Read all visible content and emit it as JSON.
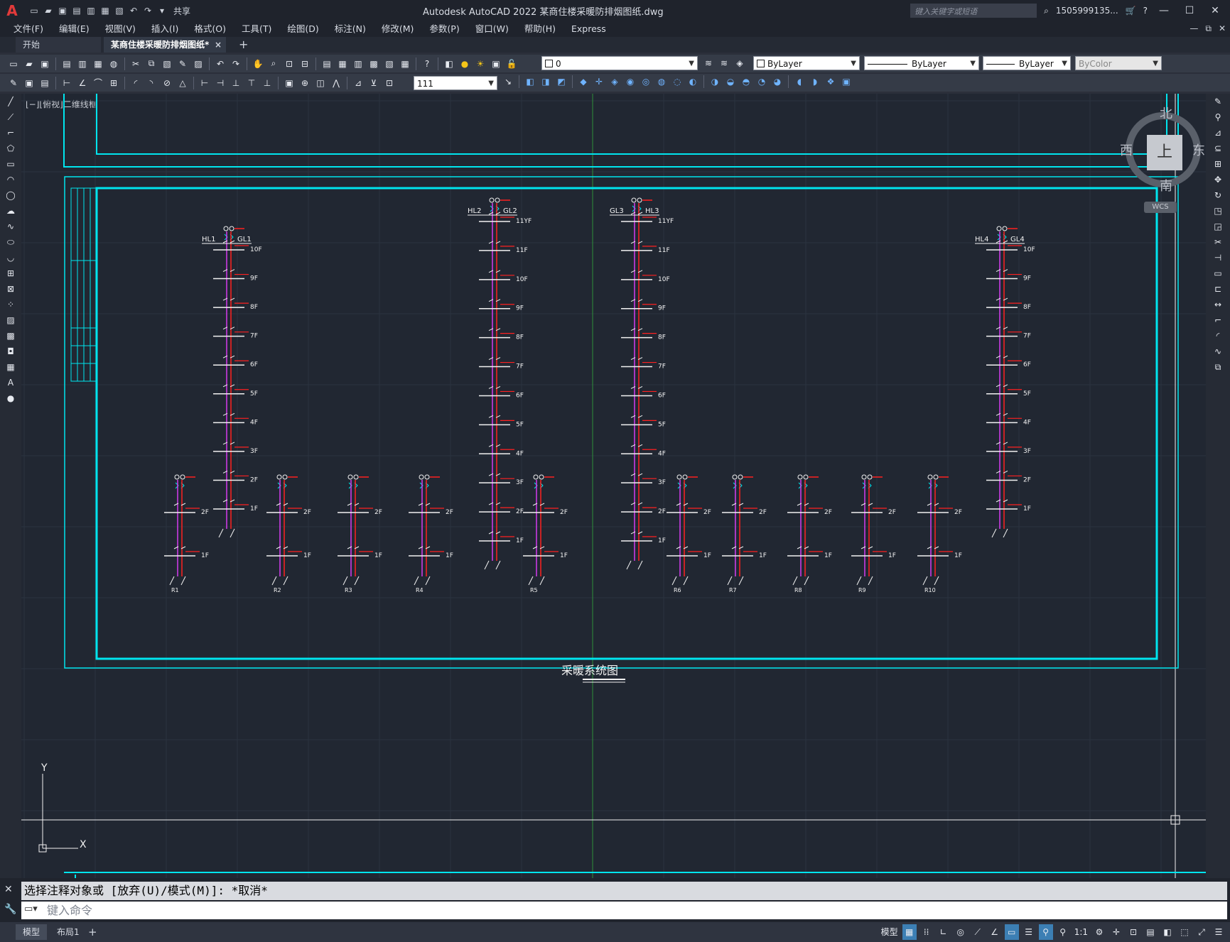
{
  "app": {
    "title": "Autodesk AutoCAD 2022    某商住楼采暖防排烟图纸.dwg",
    "logo": "A",
    "share_label": "共享",
    "search_placeholder": "键入关键字或短语",
    "user": "1505999135...",
    "window_controls": [
      "—",
      "☐",
      "✕"
    ]
  },
  "menu": {
    "items": [
      "文件(F)",
      "编辑(E)",
      "视图(V)",
      "插入(I)",
      "格式(O)",
      "工具(T)",
      "绘图(D)",
      "标注(N)",
      "修改(M)",
      "参数(P)",
      "窗口(W)",
      "帮助(H)",
      "Express"
    ],
    "right_controls": [
      "—",
      "⧉",
      "✕"
    ]
  },
  "tabs": {
    "start": "开始",
    "active": "某商住楼采暖防排烟图纸*",
    "close": "×",
    "add": "+"
  },
  "toolbar": {
    "layer_value": "0",
    "color_value": "ByLayer",
    "linetype_value": "ByLayer",
    "lineweight_value": "ByLayer",
    "plotstyle_value": "ByColor",
    "dimstyle_value": "111"
  },
  "canvas": {
    "view_label": "[−][俯视]二维线框",
    "drawing_title": "采暖系统图",
    "viewcube": {
      "north": "北",
      "south": "南",
      "east": "东",
      "west": "西",
      "face": "上",
      "wcs": "WCS"
    },
    "ucs": {
      "x": "X",
      "y": "Y"
    }
  },
  "risers_tall": [
    {
      "left_label": "HL1",
      "right_label": "GL1",
      "floors": [
        "10F",
        "9F",
        "8F",
        "7F",
        "6F",
        "5F",
        "4F",
        "3F",
        "2F",
        "1F"
      ]
    },
    {
      "left_label": "HL2",
      "right_label": "GL2",
      "floors": [
        "11YF",
        "11F",
        "10F",
        "9F",
        "8F",
        "7F",
        "6F",
        "5F",
        "4F",
        "3F",
        "2F",
        "1F"
      ]
    },
    {
      "left_label": "GL3",
      "right_label": "HL3",
      "floors": [
        "11YF",
        "11F",
        "10F",
        "9F",
        "8F",
        "7F",
        "6F",
        "5F",
        "4F",
        "3F",
        "2F",
        "1F"
      ]
    },
    {
      "left_label": "HL4",
      "right_label": "GL4",
      "floors": [
        "10F",
        "9F",
        "8F",
        "7F",
        "6F",
        "5F",
        "4F",
        "3F",
        "2F",
        "1F"
      ]
    }
  ],
  "risers_short": [
    {
      "label": "R1",
      "floors": [
        "2F",
        "1F"
      ]
    },
    {
      "label": "R2",
      "floors": [
        "2F",
        "1F"
      ]
    },
    {
      "label": "R3",
      "floors": [
        "2F",
        "1F"
      ]
    },
    {
      "label": "R4",
      "floors": [
        "2F",
        "1F"
      ]
    },
    {
      "label": "R5",
      "floors": [
        "2F",
        "1F"
      ]
    },
    {
      "label": "R6",
      "floors": [
        "2F",
        "1F"
      ]
    },
    {
      "label": "R7",
      "floors": [
        "2F",
        "1F"
      ]
    },
    {
      "label": "R8",
      "floors": [
        "2F",
        "1F"
      ]
    },
    {
      "label": "R9",
      "floors": [
        "2F",
        "1F"
      ]
    },
    {
      "label": "R10",
      "floors": [
        "2F",
        "1F"
      ]
    }
  ],
  "command": {
    "history": "选择注释对象或 [放弃(U)/模式(M)]: *取消*",
    "placeholder": "键入命令"
  },
  "status": {
    "model_tab": "模型",
    "layout_tab": "布局1",
    "add": "+",
    "model_label": "模型",
    "scale": "1:1"
  },
  "colors": {
    "cyan": "#00e5ee",
    "magenta": "#d63cf0",
    "red": "#ff2020",
    "white": "#f2f2f2",
    "canvas_bg": "#212732",
    "accent_blue": "#3c7fb4"
  }
}
